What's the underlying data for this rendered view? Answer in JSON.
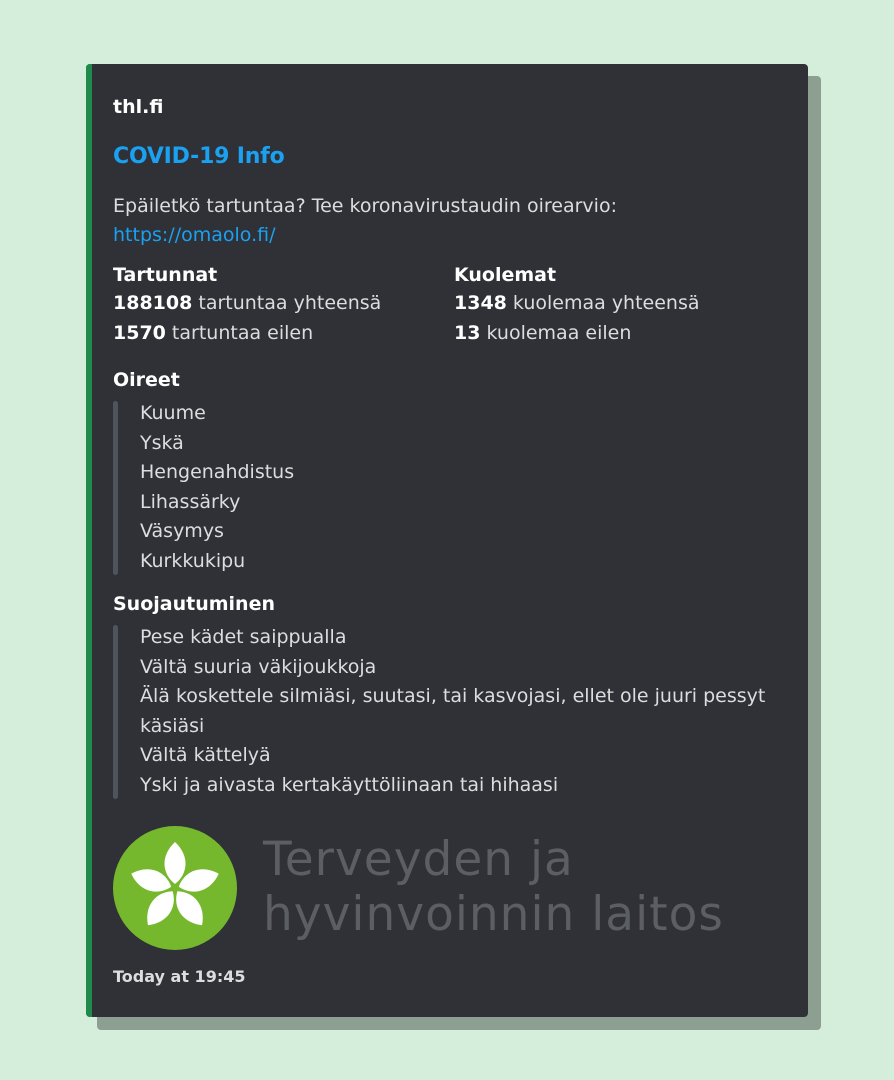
{
  "embed": {
    "author": "thl.fi",
    "title": "COVID-19 Info",
    "description_text": "Epäiletkö tartuntaa? Tee koronavirustaudin oirearvio:",
    "description_link": "https://omaolo.fi/",
    "accent_color": "#1f8a4c",
    "footer_timestamp": "Today at 19:45"
  },
  "fields": {
    "infections": {
      "name": "Tartunnat",
      "total_value": "188108",
      "total_label": " tartuntaa yhteensä",
      "yesterday_value": "1570",
      "yesterday_label": " tartuntaa eilen"
    },
    "deaths": {
      "name": "Kuolemat",
      "total_value": "1348",
      "total_label": " kuolemaa yhteensä",
      "yesterday_value": "13",
      "yesterday_label": " kuolemaa eilen"
    },
    "symptoms": {
      "name": "Oireet",
      "items": [
        "Kuume",
        "Yskä",
        "Hengenahdistus",
        "Lihassärky",
        "Väsymys",
        "Kurkkukipu"
      ]
    },
    "protection": {
      "name": "Suojautuminen",
      "items": [
        "Pese kädet saippualla",
        "Vältä suuria väkijoukkoja",
        "Älä koskettele silmiäsi, suutasi, tai kasvojasi, ellet ole juuri pessyt käsiäsi",
        "Vältä kättelyä",
        "Yski ja aivasta kertakäyttöliinaan tai hihaasi"
      ]
    }
  },
  "image": {
    "logo_icon": "thl-flower-logo",
    "logo_line1": "Terveyden ja",
    "logo_line2": "hyvinvoinnin laitos",
    "logo_color": "#75b72d"
  }
}
